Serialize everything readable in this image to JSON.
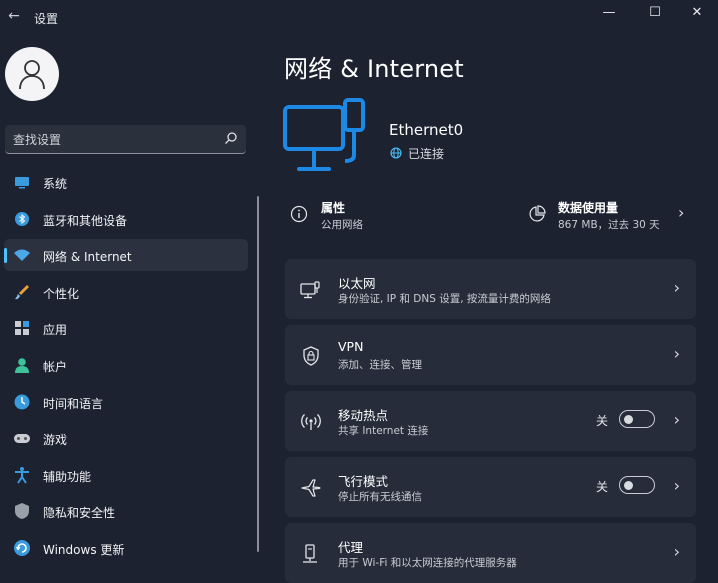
{
  "window": {
    "title": "设置",
    "back_glyph": "←",
    "minimize_glyph": "—",
    "maximize_glyph": "☐",
    "close_glyph": "✕"
  },
  "search": {
    "placeholder": "查找设置"
  },
  "sidebar": {
    "items": [
      {
        "label": "系统",
        "icon": "system-icon"
      },
      {
        "label": "蓝牙和其他设备",
        "icon": "bluetooth-icon"
      },
      {
        "label": "网络 & Internet",
        "icon": "network-icon",
        "active": true
      },
      {
        "label": "个性化",
        "icon": "brush-icon"
      },
      {
        "label": "应用",
        "icon": "apps-icon"
      },
      {
        "label": "帐户",
        "icon": "account-icon"
      },
      {
        "label": "时间和语言",
        "icon": "time-language-icon"
      },
      {
        "label": "游戏",
        "icon": "gaming-icon"
      },
      {
        "label": "辅助功能",
        "icon": "accessibility-icon"
      },
      {
        "label": "隐私和安全性",
        "icon": "shield-icon"
      },
      {
        "label": "Windows 更新",
        "icon": "update-icon"
      }
    ]
  },
  "main": {
    "title": "网络 & Internet",
    "adapter": {
      "name": "Ethernet0",
      "status": "已连接"
    },
    "properties": {
      "title": "属性",
      "subtitle": "公用网络"
    },
    "data_usage": {
      "title": "数据使用量",
      "subtitle": "867 MB，过去 30 天"
    },
    "chevron_glyph": "›",
    "cards": [
      {
        "title": "以太网",
        "subtitle": "身份验证, IP 和 DNS 设置, 按流量计费的网络",
        "icon": "ethernet-icon"
      },
      {
        "title": "VPN",
        "subtitle": "添加、连接、管理",
        "icon": "vpn-shield-icon"
      },
      {
        "title": "移动热点",
        "subtitle": "共享 Internet 连接",
        "icon": "hotspot-icon",
        "toggle_label": "关",
        "toggle_on": false
      },
      {
        "title": "飞行模式",
        "subtitle": "停止所有无线通信",
        "icon": "airplane-icon",
        "toggle_label": "关",
        "toggle_on": false
      },
      {
        "title": "代理",
        "subtitle": "用于 Wi-Fi 和以太网连接的代理服务器",
        "icon": "proxy-icon"
      }
    ]
  },
  "colors": {
    "accent": "#4cc2ff",
    "monitor_blue": "#1e88e5",
    "background": "#1c2230",
    "card": "#262c39"
  }
}
